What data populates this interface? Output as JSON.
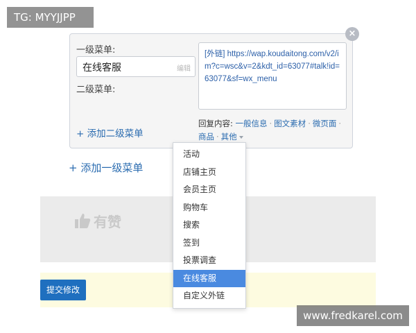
{
  "watermark_top": "TG: MYYJJPP",
  "watermark_bottom": "www.fredkarel.com",
  "menu_editor": {
    "close_icon": "×",
    "first_level_label": "一级菜单:",
    "first_level_value": "在线客服",
    "edit_label": "编辑",
    "second_level_label": "二级菜单:",
    "link_text": "[外链] https://wap.koudaitong.com/v2/im?c=wsc&v=2&kdt_id=63077#talk!id=63077&sf=wx_menu",
    "add_second_level": "+ 添加二级菜单",
    "reply_label": "回复内容:",
    "reply_options": [
      "一般信息",
      "图文素材",
      "微页面",
      "商品"
    ],
    "reply_more": "其他"
  },
  "add_first_level": "+ 添加一级菜单",
  "like_text": "有赞",
  "submit_label": "提交修改",
  "dropdown": {
    "items": [
      "活动",
      "店铺主页",
      "会员主页",
      "购物车",
      "搜索",
      "签到",
      "投票调查",
      "在线客服",
      "自定义外链"
    ],
    "selected": "在线客服"
  },
  "colors": {
    "accent": "#2b6cb0",
    "selected_bg": "#4a8ae0",
    "submit_bg": "#1f6fbf",
    "yellow_bar": "#fdfbe0"
  }
}
